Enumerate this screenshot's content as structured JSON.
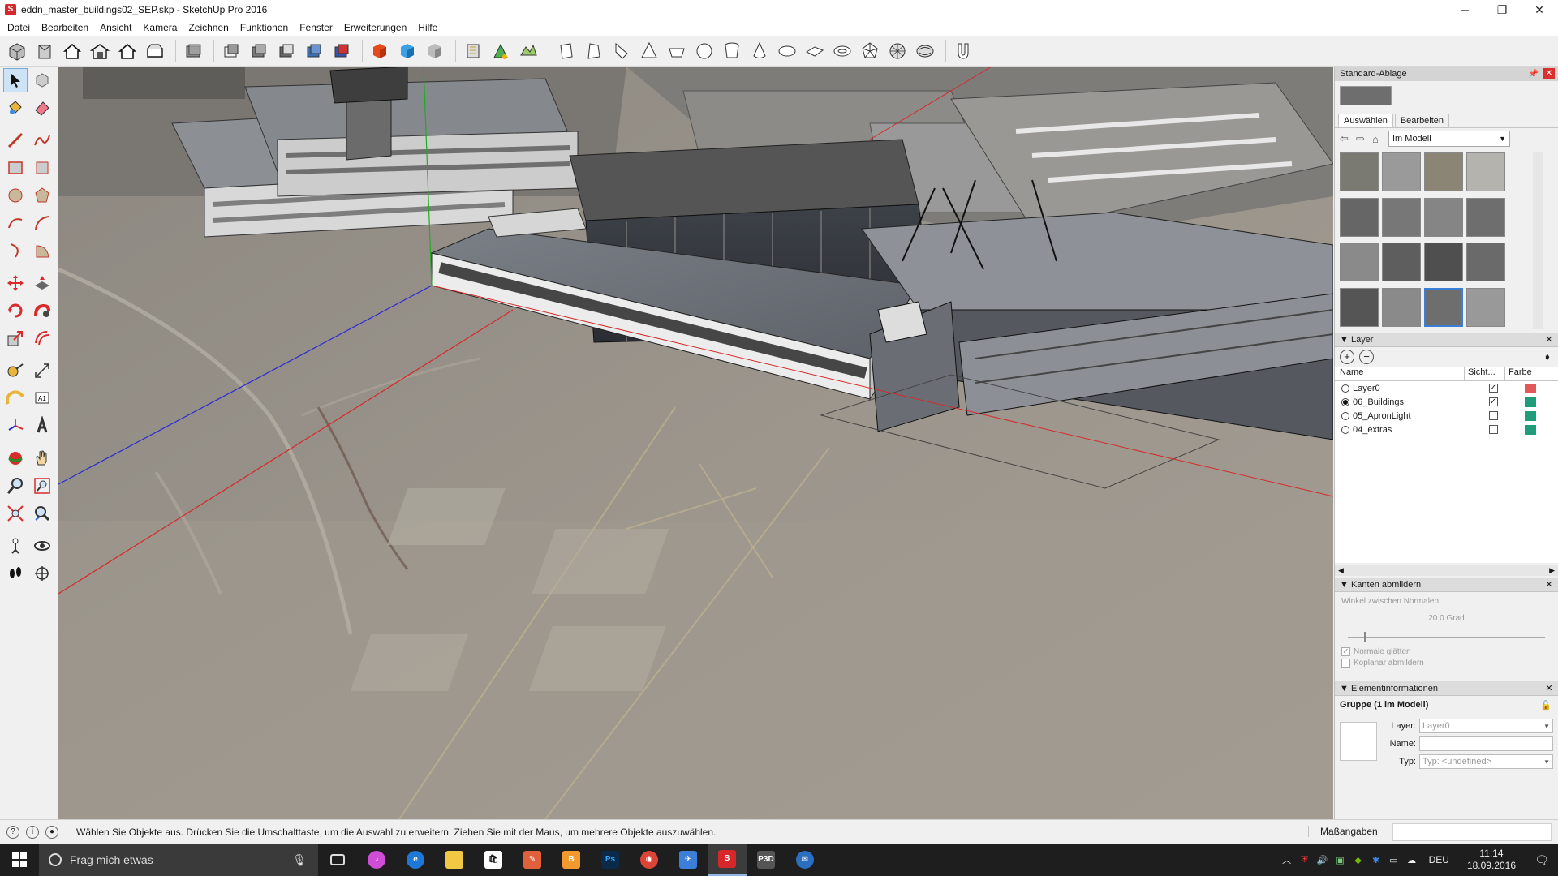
{
  "titlebar": {
    "title": "eddn_master_buildings02_SEP.skp - SketchUp Pro 2016",
    "minimize": "─",
    "maximize": "❐",
    "close": "✕"
  },
  "menu": [
    "Datei",
    "Bearbeiten",
    "Ansicht",
    "Kamera",
    "Zeichnen",
    "Funktionen",
    "Fenster",
    "Erweiterungen",
    "Hilfe"
  ],
  "tray": {
    "title": "Standard-Ablage",
    "materials": {
      "tabs": [
        "Auswählen",
        "Bearbeiten"
      ],
      "collection": "Im Modell"
    },
    "layers": {
      "title": "Layer",
      "col_name": "Name",
      "col_visible": "Sicht...",
      "col_color": "Farbe",
      "rows": [
        {
          "name": "Layer0",
          "active": false,
          "visible": true,
          "color": "#e05a5a"
        },
        {
          "name": "06_Buildings",
          "active": true,
          "visible": true,
          "color": "#1f9c7a"
        },
        {
          "name": "05_ApronLight",
          "active": false,
          "visible": false,
          "color": "#1f9c7a"
        },
        {
          "name": "04_extras",
          "active": false,
          "visible": false,
          "color": "#1f9c7a"
        }
      ]
    },
    "soften": {
      "title": "Kanten abmildern",
      "angle_label": "Winkel zwischen Normalen:",
      "angle_value": "20.0  Grad",
      "smooth_normals": "Normale glätten",
      "coplanar": "Koplanar abmildern"
    },
    "entity": {
      "title": "Elementinformationen",
      "heading": "Gruppe (1 im Modell)",
      "layer_label": "Layer:",
      "layer_value": "Layer0",
      "name_label": "Name:",
      "name_value": "",
      "type_label": "Typ:",
      "type_value": "Typ: <undefined>"
    }
  },
  "statusbar": {
    "hint": "Wählen Sie Objekte aus. Drücken Sie die Umschalttaste, um die Auswahl zu erweitern. Ziehen Sie mit der Maus, um mehrere Objekte auszuwählen.",
    "measure_label": "Maßangaben"
  },
  "taskbar": {
    "search_placeholder": "Frag mich etwas",
    "lang": "DEU",
    "time": "11:14",
    "date": "18.09.2016"
  },
  "colors": {
    "axis_red": "#d62a2a",
    "axis_green": "#22aa22",
    "axis_blue": "#2a2ad6"
  }
}
